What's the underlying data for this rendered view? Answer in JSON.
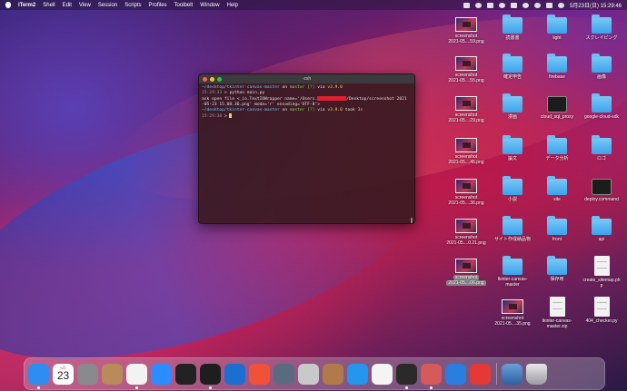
{
  "menubar": {
    "app": "iTerm2",
    "menus": [
      "Shell",
      "Edit",
      "View",
      "Session",
      "Scripts",
      "Profiles",
      "Toolbelt",
      "Window",
      "Help"
    ],
    "clock": "5月23日(日)  15:29:46"
  },
  "terminal": {
    "title": "-zsh",
    "lines": {
      "l1_path": "~/desktop/tkinter-canvas-master",
      "l1_on": " on ",
      "l1_branch": "master [?]",
      "l1_via": " via ",
      "l1_ver": "v3.9.0",
      "l2_time": "15:29:33",
      "l2_cmd": " > python main.py",
      "l3a": "ask open file <_io.TextIOWrapper name='/Users.",
      "l3b": "/Desktop/screenshot 2021",
      "l4": "-05-23 15.08.36.png' mode='r' encoding='UTF-8'>",
      "l5_path": "~/desktop/tkinter-canvas-master",
      "l5_on": " on ",
      "l5_branch": "master [?]",
      "l5_via": " via ",
      "l5_ver": "v3.9.0",
      "l5_took": " took ",
      "l5_dur": "3s",
      "l6_time": "15:29:38",
      "l6_prompt": " > "
    }
  },
  "desktop": {
    "col1": [
      {
        "type": "thumb",
        "label1": "screenshot",
        "label2": "2021-05....59.png"
      },
      {
        "type": "thumb",
        "label1": "screenshot",
        "label2": "2021-05....55.png"
      },
      {
        "type": "thumb",
        "label1": "screenshot",
        "label2": "2021-05....29.png"
      },
      {
        "type": "thumb",
        "label1": "screenshot",
        "label2": "2021-05....45.png"
      },
      {
        "type": "thumb",
        "label1": "screenshot",
        "label2": "2021-05....36.png"
      },
      {
        "type": "thumb",
        "label1": "screenshot",
        "label2": "2021-05....0.21.png"
      },
      {
        "type": "thumb",
        "label1": "screenshot",
        "label2": "2021-05....06.png",
        "selected": true
      }
    ],
    "col2": [
      {
        "type": "folder",
        "label1": "読書書",
        "label2": ""
      },
      {
        "type": "folder",
        "label1": "確定申告",
        "label2": ""
      },
      {
        "type": "folder",
        "label1": "漫画",
        "label2": ""
      },
      {
        "type": "folder",
        "label1": "論文",
        "label2": ""
      },
      {
        "type": "folder",
        "label1": "小説",
        "label2": ""
      },
      {
        "type": "folder",
        "label1": "サイト作成納品物",
        "label2": ""
      },
      {
        "type": "folder",
        "label1": "tkinter-canvas-",
        "label2": "master"
      },
      {
        "type": "thumb",
        "label1": "screenshot",
        "label2": "2021-05....35.png"
      }
    ],
    "col3": [
      {
        "type": "folder",
        "label1": "light",
        "label2": ""
      },
      {
        "type": "folder",
        "label1": "firebase",
        "label2": ""
      },
      {
        "type": "black",
        "label1": "cloud_sql_proxy",
        "label2": ""
      },
      {
        "type": "folder",
        "label1": "データ分析",
        "label2": ""
      },
      {
        "type": "folder",
        "label1": "site",
        "label2": ""
      },
      {
        "type": "folder",
        "label1": "front",
        "label2": ""
      },
      {
        "type": "folder",
        "label1": "保存用",
        "label2": ""
      },
      {
        "type": "doc",
        "label1": "tkinter-canvas-",
        "label2": "master.zip"
      }
    ],
    "col4": [
      {
        "type": "folder",
        "label1": "スクレイピング",
        "label2": ""
      },
      {
        "type": "folder",
        "label1": "画像",
        "label2": ""
      },
      {
        "type": "folder",
        "label1": "google-cloud-sdk",
        "label2": ""
      },
      {
        "type": "folder",
        "label1": "ロゴ",
        "label2": ""
      },
      {
        "type": "black",
        "label1": "deploy.command",
        "label2": ""
      },
      {
        "type": "folder",
        "label1": "api",
        "label2": ""
      },
      {
        "type": "doc",
        "label1": "create_sitemap.ph",
        "label2": "p"
      },
      {
        "type": "doc",
        "label1": "404_checker.py",
        "label2": ""
      }
    ]
  },
  "dock": {
    "calendar_month": "5月",
    "calendar_day": "23",
    "apps": [
      {
        "name": "finder-icon",
        "color": "#2f8df0"
      },
      {
        "name": "calendar-icon",
        "color": "#ffffff"
      },
      {
        "name": "system-preferences-icon",
        "color": "#8a8a8e"
      },
      {
        "name": "contacts-icon",
        "color": "#b98a5a"
      },
      {
        "name": "chrome-icon",
        "color": "#f2f2f2"
      },
      {
        "name": "zoom-icon",
        "color": "#2d8cff"
      },
      {
        "name": "activity-monitor-icon",
        "color": "#222222"
      },
      {
        "name": "terminal-icon",
        "color": "#1e1e1e"
      },
      {
        "name": "vscode-icon",
        "color": "#1a6fd0"
      },
      {
        "name": "swift-playgrounds-icon",
        "color": "#f05138"
      },
      {
        "name": "quicktime-icon",
        "color": "#5a6b80"
      },
      {
        "name": "sequel-pro-icon",
        "color": "#c9c9c9"
      },
      {
        "name": "box-icon",
        "color": "#b07a4a"
      },
      {
        "name": "docker-icon",
        "color": "#2496ed"
      },
      {
        "name": "sourcetree-icon",
        "color": "#f4f4f4"
      },
      {
        "name": "iterm-icon",
        "color": "#2a2a2a"
      },
      {
        "name": "preview-icon",
        "color": "#d65a5a"
      },
      {
        "name": "arduino-icon",
        "color": "#2a7ee0"
      },
      {
        "name": "clock-icon",
        "color": "#e53935"
      }
    ]
  }
}
